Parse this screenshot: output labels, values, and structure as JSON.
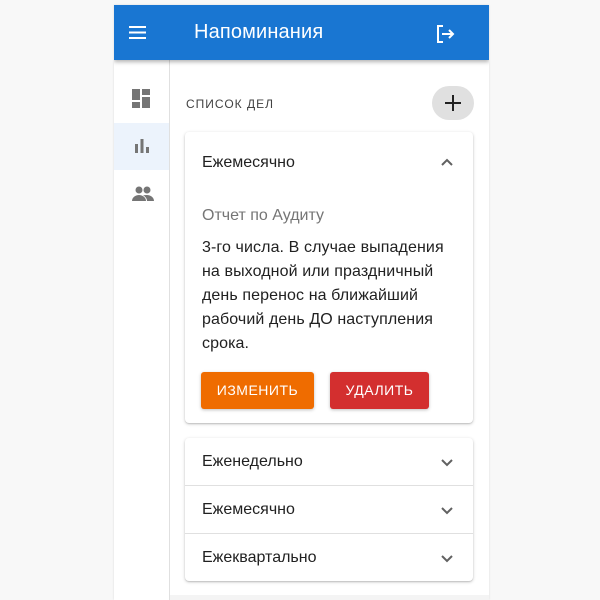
{
  "appbar": {
    "title": "Напоминания",
    "menu_icon": "menu-icon",
    "logout_icon": "logout-icon",
    "color": "#1976d2"
  },
  "sidebar": {
    "items": [
      {
        "name": "dashboard",
        "icon": "dashboard-icon",
        "active": false
      },
      {
        "name": "reports",
        "icon": "bar-chart-icon",
        "active": true
      },
      {
        "name": "people",
        "icon": "people-icon",
        "active": false
      }
    ]
  },
  "main": {
    "section_label": "Список дел",
    "add_icon": "plus-icon",
    "expanded_panel": {
      "label": "Ежемесячно",
      "subtitle": "Отчет по Аудиту",
      "body": "3-го числа. В случае выпадения на выходной или праздничный день перенос на ближайший рабочий день ДО наступления срока.",
      "edit_label": "ИЗМЕНИТЬ",
      "delete_label": "УДАЛИТЬ",
      "edit_color": "#ef6c00",
      "delete_color": "#d32f2f"
    },
    "collapsed_panels": [
      {
        "label": "Еженедельно"
      },
      {
        "label": "Ежемесячно"
      },
      {
        "label": "Ежеквартально"
      }
    ]
  }
}
